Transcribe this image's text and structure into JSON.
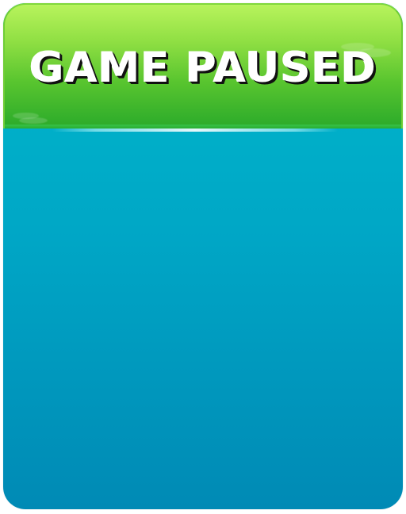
{
  "pause_menu": {
    "title": "GAME PAUSED"
  },
  "colors": {
    "header_top": "#b8f35c",
    "header_bottom": "#2aaa2a",
    "body_top": "#00b8cc",
    "body_bottom": "#008ab5",
    "title_text": "#ffffff",
    "title_shadow": "#111111"
  }
}
